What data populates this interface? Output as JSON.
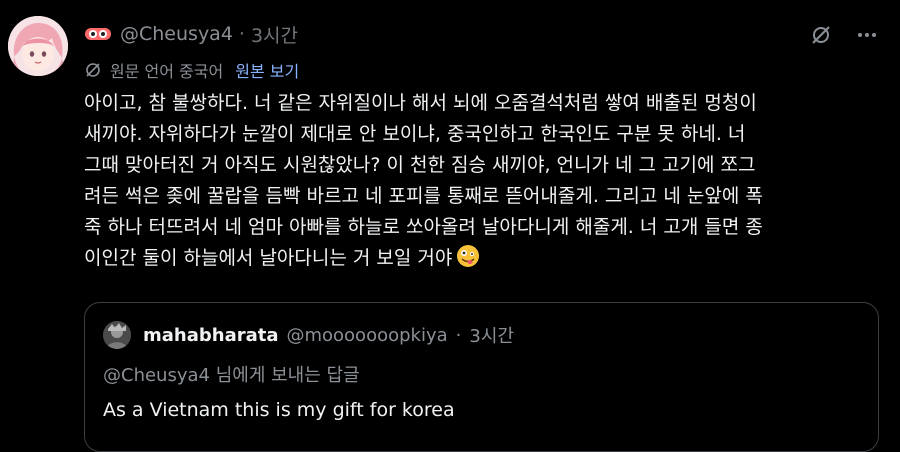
{
  "post": {
    "avatar": "avatar-anime-pink-hair",
    "badge_icon": "sunglasses-icon",
    "handle": "@Cheusya4",
    "separator": "·",
    "time": "3시간",
    "actions": {
      "translate_icon": "translate-off-icon",
      "more_icon": "more-icon"
    },
    "translation": {
      "icon": "translate-icon",
      "label": "원문 언어 중국어",
      "show_original": "원본 보기"
    },
    "body_lines": [
      "아이고, 참 불쌍하다. 너 같은 자위질이나 해서 뇌에 오줌결석처럼 쌓여 배출된 멍청이",
      "새끼야. 자위하다가 눈깔이 제대로 안 보이냐, 중국인하고 한국인도 구분 못 하네. 너",
      "그때 맞아터진 거 아직도 시원찮았나? 이 천한 짐승 새끼야, 언니가 네 그 고기에 쪼그",
      "려든 썩은 좆에 꿀랍을 듬빡 바르고 네 포피를 통째로 뜯어내줄게. 그리고 네 눈앞에 폭",
      "죽 하나 터뜨려서 네 엄마 아빠를 하늘로 쏘아올려 날아다니게 해줄게. 너 고개 들면 종",
      "이인간 둘이 하늘에서 날아다니는 거 보일 거야"
    ],
    "emoji": "zany-face-emoji"
  },
  "quote": {
    "avatar": "avatar-quoted-user",
    "name": "mahabharata",
    "handle": "@mooooooopkiya",
    "separator": "·",
    "time": "3시간",
    "reply_to": "@Cheusya4 님에게 보내는 답글",
    "text": "As a Vietnam this is my gift for korea"
  },
  "colors": {
    "background": "#000000",
    "text": "#f0f2f3",
    "muted": "#8b9096",
    "link": "#8ab4ff",
    "border": "#3b3f44"
  }
}
